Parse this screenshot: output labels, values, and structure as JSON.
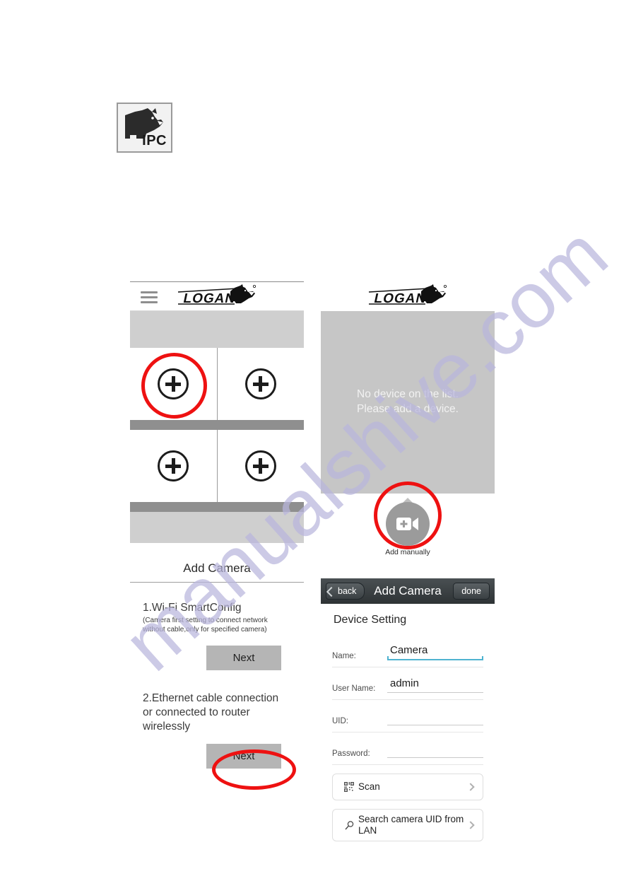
{
  "app_icon": {
    "label": "IPC",
    "icon": "wolf-head-icon"
  },
  "left_phone": {
    "brand": "LOGAN",
    "menu_icon": "hamburger-menu-icon",
    "grid": {
      "cells": [
        {
          "icon": "plus-circle-icon",
          "annotated": true
        },
        {
          "icon": "plus-circle-icon",
          "annotated": false
        },
        {
          "icon": "plus-circle-icon",
          "annotated": false
        },
        {
          "icon": "plus-circle-icon",
          "annotated": false
        }
      ]
    },
    "add_camera": {
      "title": "Add Camera",
      "step1_heading": "1.Wi-Fi SmartConfig",
      "step1_note": "(Camera first setting to connect network without cable,only for specified camera)",
      "step1_button": "Next",
      "step2_heading": "2.Ethernet cable connection or connected to router wirelessly",
      "step2_button": "Next"
    }
  },
  "right_phone_top": {
    "brand": "LOGAN",
    "empty_message_line1": "No device on the list.",
    "empty_message_line2": "Please add a device.",
    "add_manually_label": "Add manually",
    "add_manually_icon": "camera-plus-icon"
  },
  "right_phone_bottom": {
    "titlebar": {
      "back_label": "back",
      "title": "Add Camera",
      "done_label": "done"
    },
    "section_title": "Device Setting",
    "fields": [
      {
        "label": "Name:",
        "value": "Camera",
        "focused": true
      },
      {
        "label": "User Name:",
        "value": "admin",
        "focused": false
      },
      {
        "label": "UID:",
        "value": "",
        "focused": false
      },
      {
        "label": "Password:",
        "value": "",
        "focused": false
      }
    ],
    "actions": [
      {
        "label": "Scan",
        "icon": "qr-code-icon"
      },
      {
        "label": "Search camera UID from LAN",
        "icon": "search-magnifier-icon"
      }
    ]
  },
  "watermark": {
    "text": "manualshive.com"
  },
  "colors": {
    "annotation_red": "#ee1111",
    "focus_underline": "#4fb3d0",
    "band_light": "#cfcfcf",
    "band_dark": "#8f8f8f",
    "device_area": "#c6c6c6",
    "button_gray": "#b5b5b5"
  }
}
